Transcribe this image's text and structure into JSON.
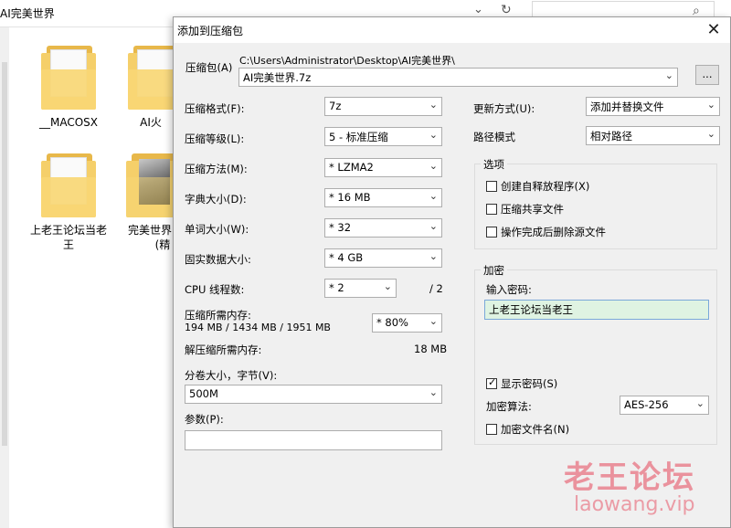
{
  "explorer": {
    "path": "AI完美世界",
    "folders": [
      {
        "name": "__MACOSX"
      },
      {
        "name": "AI火"
      },
      {
        "name": "上老王论坛当老王"
      },
      {
        "name": "完美世界"
      },
      {
        "name_extra": "(精"
      }
    ]
  },
  "dialog": {
    "title": "添加到压缩包",
    "archive": {
      "label": "压缩包(A)",
      "path": "C:\\Users\\Administrator\\Desktop\\AI完美世界\\",
      "name": "AI完美世界.7z",
      "browse": "..."
    },
    "left": {
      "format_label": "压缩格式(F):",
      "format": "7z",
      "level_label": "压缩等级(L):",
      "level": "5 - 标准压缩",
      "method_label": "压缩方法(M):",
      "method": "* LZMA2",
      "dict_label": "字典大小(D):",
      "dict": "* 16 MB",
      "word_label": "单词大小(W):",
      "word": "* 32",
      "solid_label": "固实数据大小:",
      "solid": "* 4 GB",
      "cpu_label": "CPU 线程数:",
      "cpu": "* 2",
      "cpu_total": "/ 2",
      "mem_label": "压缩所需内存:",
      "mem_values": "194 MB / 1434 MB / 1951 MB",
      "mem_pct": "* 80%",
      "decomp_label": "解压缩所需内存:",
      "decomp_value": "18 MB",
      "volume_label": "分卷大小，字节(V):",
      "volume": "500M",
      "params_label": "参数(P):",
      "params": ""
    },
    "right": {
      "update_label": "更新方式(U):",
      "update": "添加并替换文件",
      "pathmode_label": "路径模式",
      "pathmode": "相对路径",
      "options_title": "选项",
      "opt_sfx": "创建自释放程序(X)",
      "opt_shared": "压缩共享文件",
      "opt_delete": "操作完成后删除源文件",
      "enc_title": "加密",
      "pw_label": "输入密码:",
      "password": "上老王论坛当老王",
      "show_pw": "显示密码(S)",
      "enc_method_label": "加密算法:",
      "enc_method": "AES-256",
      "enc_names": "加密文件名(N)"
    }
  },
  "watermark": {
    "title": "老王论坛",
    "url": "laowang.vip"
  }
}
